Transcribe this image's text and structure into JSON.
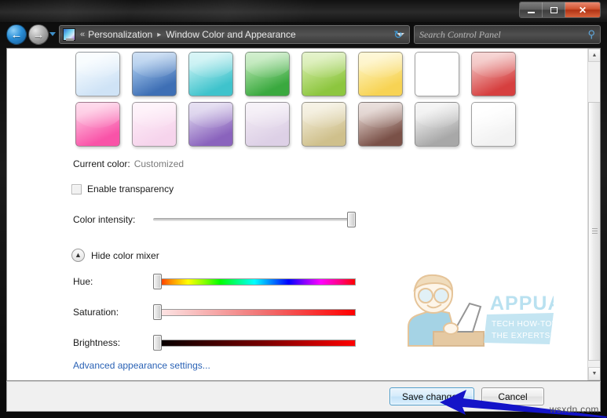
{
  "window": {
    "controls": {
      "minimize": "minimize",
      "maximize": "restore",
      "close": "✕"
    }
  },
  "nav": {
    "back_glyph": "←",
    "forward_glyph": "→",
    "refresh_glyph": "↻",
    "address": {
      "leading_separator": "«",
      "crumbs": [
        "Personalization",
        "Window Color and Appearance"
      ],
      "crumb_arrow": "▸"
    },
    "search": {
      "placeholder": "Search Control Panel",
      "icon_glyph": "⚲"
    }
  },
  "content": {
    "swatches": [
      {
        "name": "sky-blue",
        "start": "#f4fafe",
        "end": "#cfe3f6"
      },
      {
        "name": "blue",
        "start": "#9dc0e8",
        "end": "#3e6fb5"
      },
      {
        "name": "teal",
        "start": "#b5ecef",
        "end": "#3fc3cc"
      },
      {
        "name": "green",
        "start": "#a7dfa0",
        "end": "#3aa93f"
      },
      {
        "name": "lime",
        "start": "#cbe79a",
        "end": "#8dc63f"
      },
      {
        "name": "yellow",
        "start": "#fdf0b3",
        "end": "#f7d354"
      },
      {
        "name": "orange",
        "start": "#fde0b5",
        "end": "#f9a battery"
      },
      {
        "name": "red",
        "start": "#eeb0ae",
        "end": "#d63f3f"
      },
      {
        "name": "pink",
        "start": "#fdb7d9",
        "end": "#f953a8"
      },
      {
        "name": "light-pink",
        "start": "#fdeaf6",
        "end": "#f6d4ec"
      },
      {
        "name": "purple",
        "start": "#cfc3e6",
        "end": "#8a63bd"
      },
      {
        "name": "lavender",
        "start": "#efe7f2",
        "end": "#ddd0e6"
      },
      {
        "name": "khaki",
        "start": "#eee7cf",
        "end": "#cfc08c"
      },
      {
        "name": "brown",
        "start": "#d6c3bd",
        "end": "#7a5148"
      },
      {
        "name": "gray",
        "start": "#ececec",
        "end": "#a8a8a8"
      },
      {
        "name": "white",
        "start": "#ffffff",
        "end": "#f2f2f2"
      }
    ],
    "current_color": {
      "label": "Current color:",
      "value": "Customized"
    },
    "transparency": {
      "label": "Enable transparency",
      "checked": false
    },
    "color_intensity": {
      "label": "Color intensity:",
      "value_percent": 100
    },
    "mixer": {
      "toggle_label": "Hide color mixer",
      "chevron_glyph": "▲",
      "sliders": [
        {
          "label": "Hue:",
          "value_percent": 0
        },
        {
          "label": "Saturation:",
          "value_percent": 0
        },
        {
          "label": "Brightness:",
          "value_percent": 0
        }
      ]
    },
    "advanced_link": "Advanced appearance settings..."
  },
  "scrollbar": {
    "up_glyph": "▲",
    "down_glyph": "▼"
  },
  "commandbar": {
    "save_label": "Save changes",
    "cancel_label": "Cancel"
  },
  "annotations": {
    "site_watermark": "wsxdn.com",
    "logo": {
      "title": "APPUALS",
      "tagline_line1": "TECH HOW-TO'S FROM",
      "tagline_line2": "THE EXPERTS!",
      "accent_color": "#8fcfe8"
    },
    "arrow_color": "#1414c8"
  }
}
